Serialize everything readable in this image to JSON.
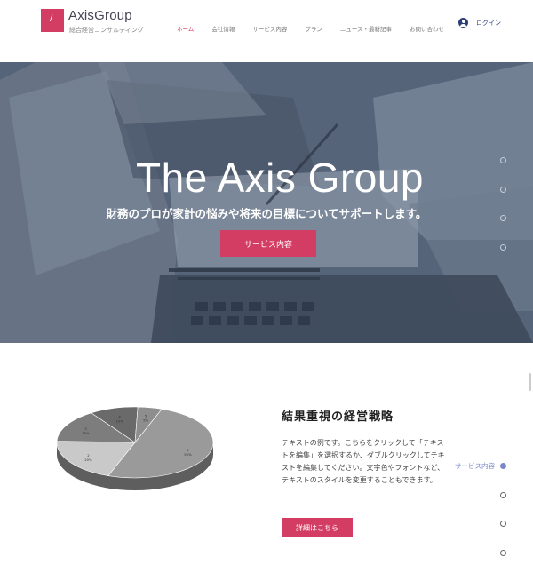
{
  "header": {
    "logo_mark": "/",
    "brand": "AxisGroup",
    "brand_sub": "総合経営コンサルティング",
    "nav": [
      "ホーム",
      "会社情報",
      "サービス内容",
      "プラン",
      "ニュース・最新記事",
      "お問い合わせ"
    ],
    "active_nav": 0,
    "login_label": "ログイン"
  },
  "hero": {
    "title": "The Axis Group",
    "subtitle": "財務のプロが家計の悩みや将来の目標についてサポートします。",
    "button_label": "サービス内容"
  },
  "side_nav": {
    "active_label": "サービス内容"
  },
  "feature": {
    "title": "結果重視の経営戦略",
    "body": "テキストの例です。こちらをクリックして「テキストを編集」を選択するか、ダブルクリックしてテキストを編集してください。文字色やフォントなど、テキストのスタイルを変更することもできます。",
    "button_label": "詳細はこちら"
  },
  "chart_data": {
    "type": "pie",
    "values": [
      50,
      20,
      15,
      10,
      5
    ],
    "labels": [
      "1\n50%",
      "2\n20%",
      "3\n15%",
      "4\n10%",
      "5\n5%"
    ],
    "colors": [
      "#9a9a9a",
      "#c9c9c9",
      "#7d7d7d",
      "#6a6a6a",
      "#8e8e8e"
    ]
  },
  "colors": {
    "accent": "#d43d63",
    "login_blue": "#2a3f7a",
    "side_active": "#7a88c8"
  }
}
